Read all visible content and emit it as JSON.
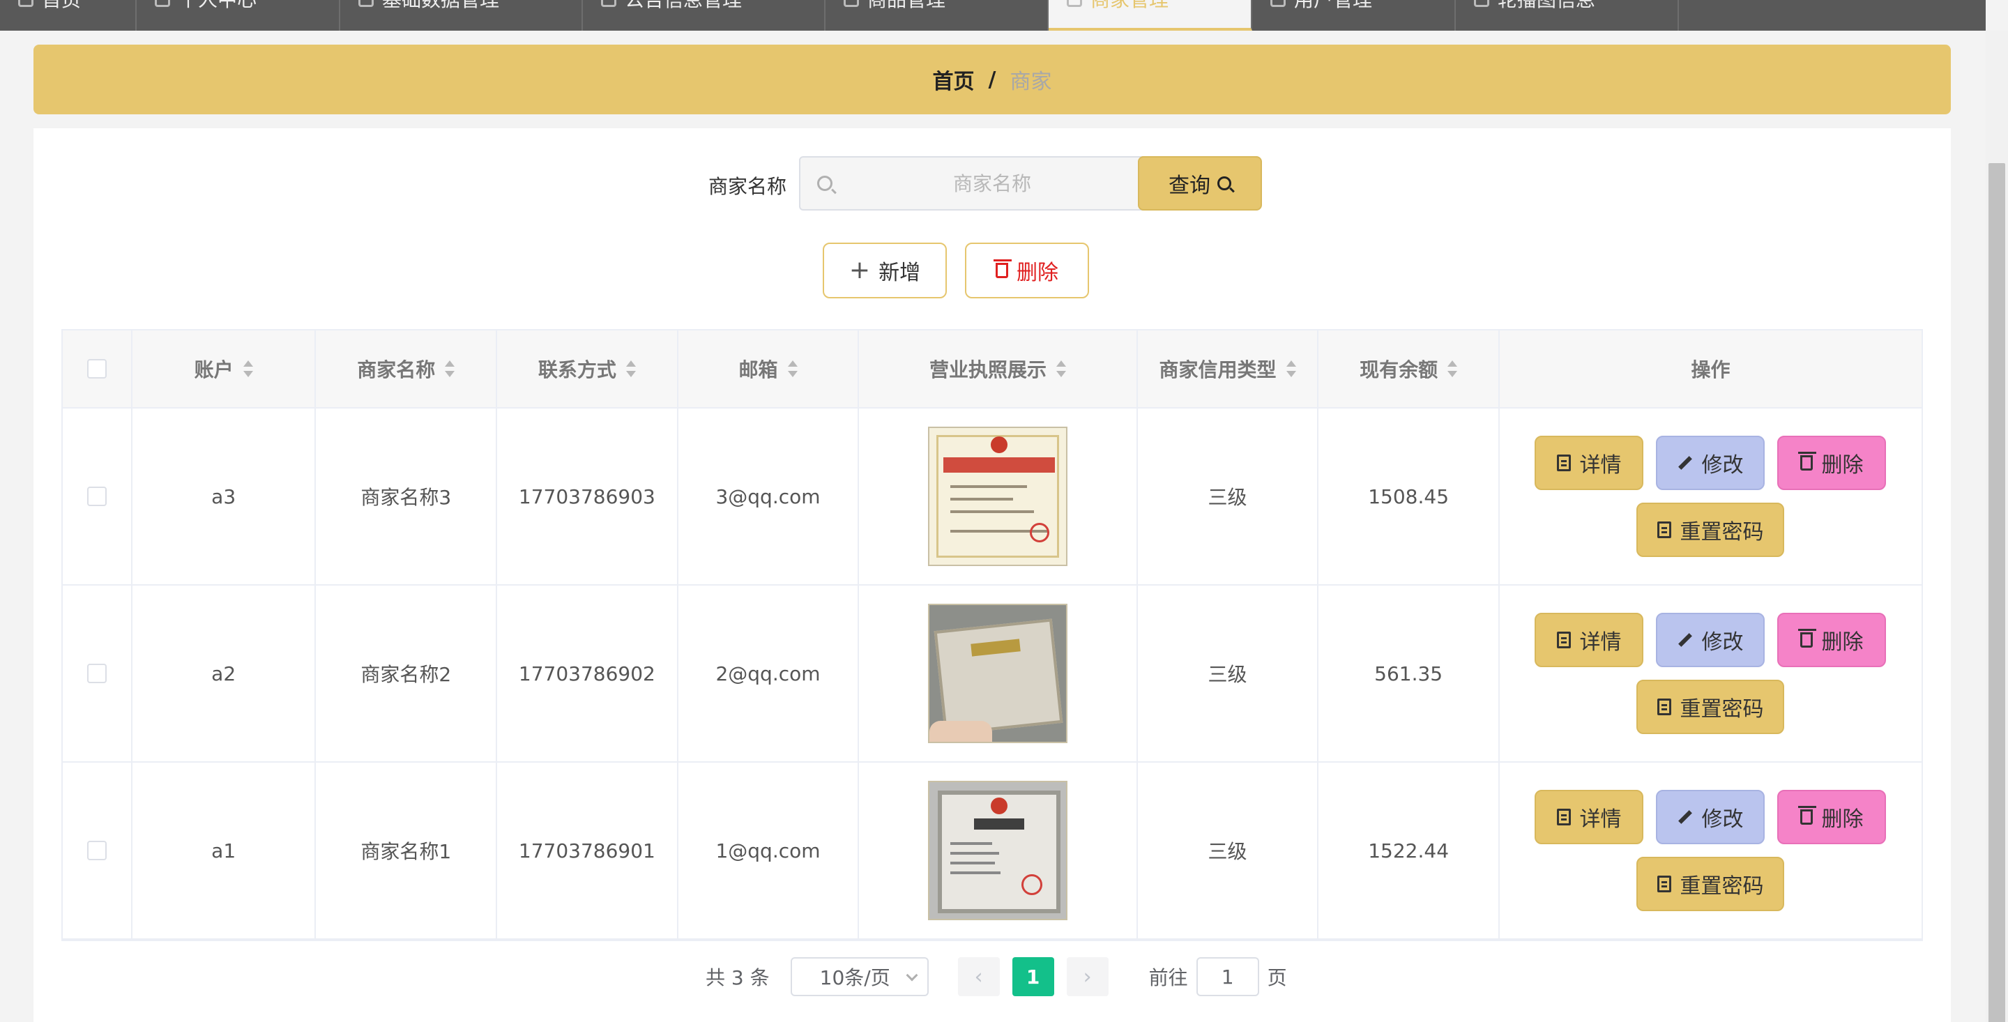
{
  "topnav": {
    "tabs": [
      {
        "label": "首页"
      },
      {
        "label": "个人中心"
      },
      {
        "label": "基础数据管理"
      },
      {
        "label": "公告信息管理"
      },
      {
        "label": "商品管理"
      },
      {
        "label": "商家管理",
        "active": true
      },
      {
        "label": "用户管理"
      },
      {
        "label": "轮播图信息"
      }
    ]
  },
  "breadcrumb": {
    "home": "首页",
    "separator": "/",
    "current": "商家"
  },
  "search": {
    "label": "商家名称",
    "placeholder": "商家名称",
    "value": "",
    "query_label": "查询"
  },
  "actions": {
    "add_label": "新增",
    "delete_label": "删除"
  },
  "table": {
    "headers": [
      "账户",
      "商家名称",
      "联系方式",
      "邮箱",
      "营业执照展示",
      "商家信用类型",
      "现有余额",
      "操作"
    ],
    "rows": [
      {
        "account": "a3",
        "name": "商家名称3",
        "phone": "17703786903",
        "email": "3@qq.com",
        "credit": "三级",
        "balance": "1508.45"
      },
      {
        "account": "a2",
        "name": "商家名称2",
        "phone": "17703786902",
        "email": "2@qq.com",
        "credit": "三级",
        "balance": "561.35"
      },
      {
        "account": "a1",
        "name": "商家名称1",
        "phone": "17703786901",
        "email": "1@qq.com",
        "credit": "三级",
        "balance": "1522.44"
      }
    ],
    "row_actions": {
      "detail": "详情",
      "edit": "修改",
      "delete": "删除",
      "reset": "重置密码"
    }
  },
  "pagination": {
    "total": "共 3 条",
    "page_size": "10条/页",
    "current_page": "1",
    "prev": "‹",
    "next": "›",
    "goto_label": "前往",
    "goto_value": "1",
    "goto_unit": "页"
  },
  "colors": {
    "accent": "#e6c66e",
    "edit": "#bac4ee",
    "delete": "#f583c8",
    "page_active": "#13c08a"
  }
}
